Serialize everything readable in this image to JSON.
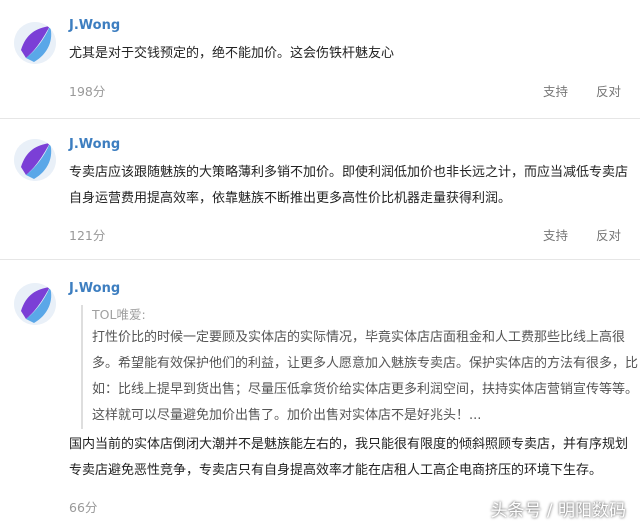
{
  "comments": [
    {
      "author": "J.Wong",
      "text": "尤其是对于交钱预定的，绝不能加价。这会伤铁杆魅友心",
      "score": "198分",
      "support": "支持",
      "oppose": "反对"
    },
    {
      "author": "J.Wong",
      "text": "专卖店应该跟随魅族的大策略薄利多销不加价。即使利润低加价也非长远之计，而应当减低专卖店自身运营费用提高效率，依靠魅族不断推出更多高性价比机器走量获得利润。",
      "score": "121分",
      "support": "支持",
      "oppose": "反对"
    },
    {
      "author": "J.Wong",
      "quote": {
        "author": "TOL唯爱:",
        "text": "打性价比的时候一定要顾及实体店的实际情况，毕竟实体店店面租金和人工费那些比线上高很多。希望能有效保护他们的利益，让更多人愿意加入魅族专卖店。保护实体店的方法有很多，比如：比线上提早到货出售；尽量压低拿货价给实体店更多利润空间，扶持实体店营销宣传等等。这样就可以尽量避免加价出售了。加价出售对实体店不是好兆头！..."
      },
      "text": "国内当前的实体店倒闭大潮并不是魅族能左右的，我只能很有限度的倾斜照顾专卖店，并有序规划专卖店避免恶性竞争，专卖店只有自身提高效率才能在店租人工高企电商挤压的环境下生存。",
      "score": "66分"
    }
  ],
  "watermark": "头条号 / 明阳数码",
  "colors": {
    "author": "#3d7ec0",
    "meta": "#999999",
    "divider": "#e6e6e6"
  }
}
